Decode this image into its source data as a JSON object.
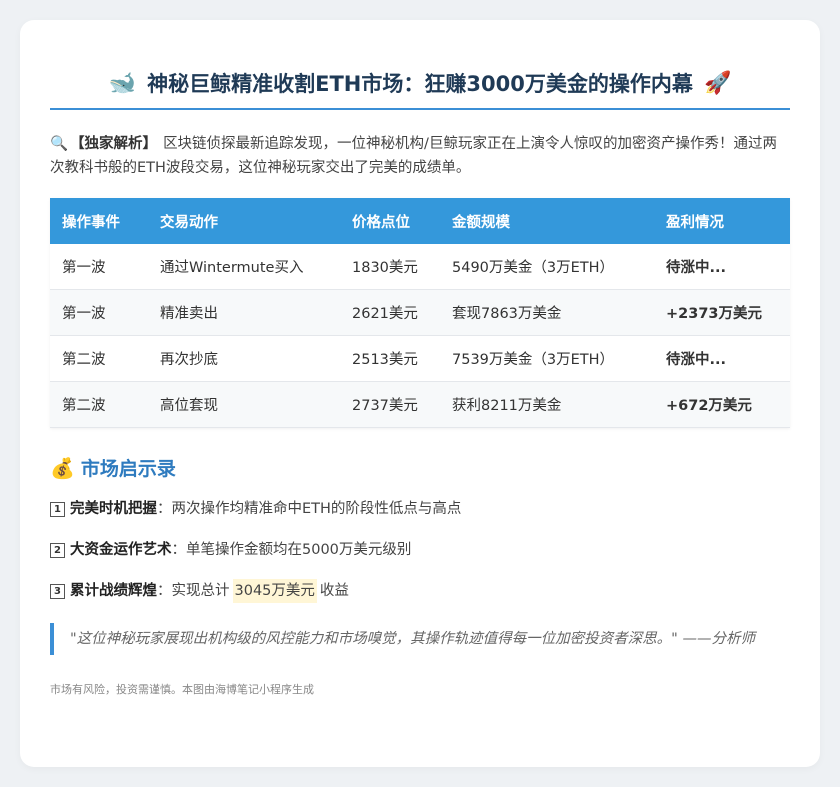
{
  "header": {
    "icon_left": "🐋",
    "title": "神秘巨鲸精准收割ETH市场：狂赚3000万美金的操作内幕",
    "icon_right": "🚀"
  },
  "intro": {
    "icon": "🔍",
    "lead": "【独家解析】",
    "text": "区块链侦探最新追踪发现，一位神秘机构/巨鲸玩家正在上演令人惊叹的加密资产操作秀！通过两次教科书般的ETH波段交易，这位神秘玩家交出了完美的成绩单。"
  },
  "table": {
    "headers": [
      "操作事件",
      "交易动作",
      "价格点位",
      "金额规模",
      "盈利情况"
    ],
    "rows": [
      {
        "event": "第一波",
        "action": "通过Wintermute买入",
        "price": "1830美元",
        "amount": "5490万美金（3万ETH）",
        "profit": "待涨中..."
      },
      {
        "event": "第一波",
        "action": "精准卖出",
        "price": "2621美元",
        "amount": "套现7863万美金",
        "profit": "+2373万美元"
      },
      {
        "event": "第二波",
        "action": "再次抄底",
        "price": "2513美元",
        "amount": "7539万美金（3万ETH）",
        "profit": "待涨中..."
      },
      {
        "event": "第二波",
        "action": "高位套现",
        "price": "2737美元",
        "amount": "获利8211万美金",
        "profit": "+672万美元"
      }
    ]
  },
  "insights": {
    "icon": "💰",
    "title": "市场启示录",
    "points": [
      {
        "num": "1",
        "title": "完美时机把握",
        "text": "：两次操作均精准命中ETH的阶段性低点与高点",
        "highlight": "",
        "suffix": ""
      },
      {
        "num": "2",
        "title": "大资金运作艺术",
        "text": "：单笔操作金额均在5000万美元级别",
        "highlight": "",
        "suffix": ""
      },
      {
        "num": "3",
        "title": "累计战绩辉煌",
        "text": "：实现总计",
        "highlight": "3045万美元",
        "suffix": "收益"
      }
    ]
  },
  "quote": "\"这位神秘玩家展现出机构级的风控能力和市场嗅觉，其操作轨迹值得每一位加密投资者深思。\" ——分析师",
  "footer": "市场有风险，投资需谨慎。本图由海博笔记小程序生成",
  "colors": {
    "accent": "#3498db",
    "profit_green": "#27a853",
    "section_title": "#2e7bbf"
  }
}
